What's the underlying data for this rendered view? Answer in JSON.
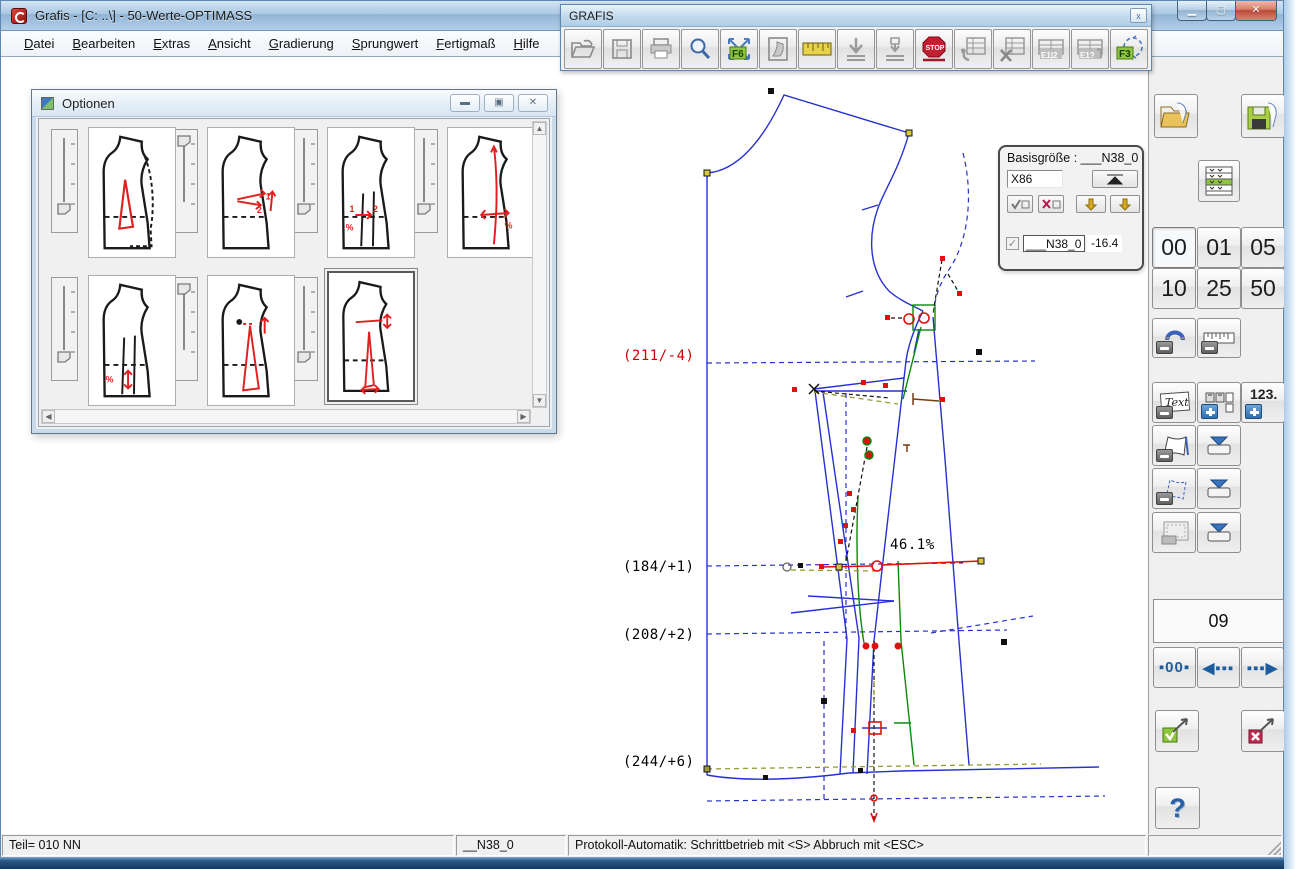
{
  "window": {
    "title": "Grafis - [C: ..\\] - 50-Werte-OPTIMASS"
  },
  "menu": {
    "items": [
      "Datei",
      "Bearbeiten",
      "Extras",
      "Ansicht",
      "Gradierung",
      "Sprungwert",
      "Fertigmaß",
      "Hilfe"
    ]
  },
  "grafis_toolbar": {
    "title": "GRAFIS",
    "close_glyph": "x",
    "f6_label": "F6",
    "stop_label": "STOP",
    "e12_label": "E1|2",
    "e1q_label": "E1?",
    "f3_label": "F3"
  },
  "optionen": {
    "title": "Optionen",
    "selected_option_index": 6,
    "option_count": 7
  },
  "basis": {
    "title": "Basisgröße : ___N38_0",
    "size_value": "X86",
    "row_label": "___N38_0",
    "row_value": "-16.4"
  },
  "sidebar": {
    "numbers": [
      "00",
      "01",
      "05",
      "10",
      "25",
      "50"
    ],
    "count_label": "123.",
    "text_icon_label": "Text",
    "counter_value": "09",
    "step_zero_label": "00",
    "help_label": "?"
  },
  "canvas": {
    "labels": {
      "l1": "(211/-4)",
      "l2": "(184/+1)",
      "l3": "(208/+2)",
      "l4": "(244/+6)",
      "pct": "46.1%"
    },
    "label_colors": {
      "l1": "#cc0000",
      "others": "#000000"
    }
  },
  "statusbar": {
    "part": "Teil= 010  NN",
    "size": "__N38_0",
    "message": "Protokoll-Automatik: Schrittbetrieb mit <S> Abbruch mit <ESC>"
  },
  "colors": {
    "pattern_blue": "#2831d0",
    "pattern_green": "#0a8a0a",
    "pattern_red": "#e01010",
    "olive": "#9a9a30"
  }
}
